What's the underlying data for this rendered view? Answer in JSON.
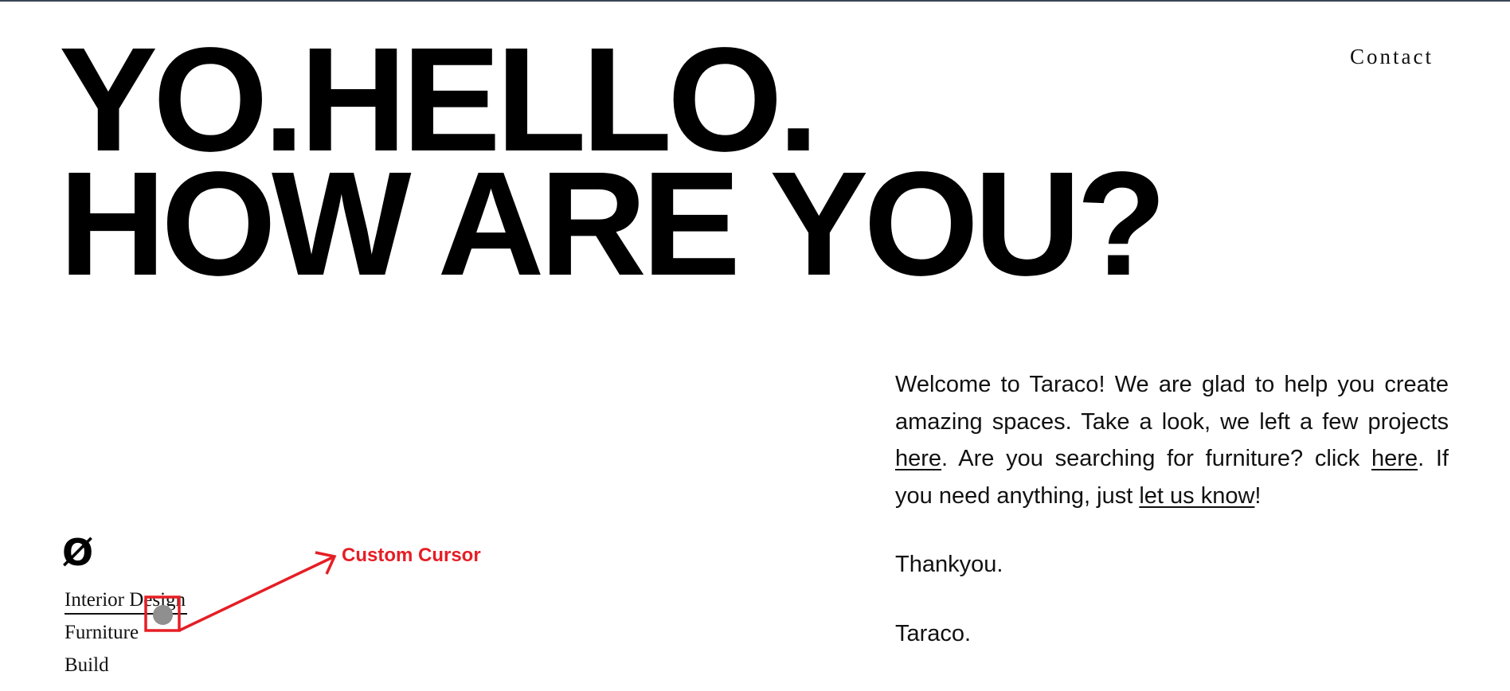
{
  "nav": {
    "contact_label": "Contact"
  },
  "hero": {
    "line1": "YO.HELLO.",
    "line2": "HOW ARE YOU?"
  },
  "brand": {
    "logo_glyph": "Ø"
  },
  "menu": {
    "items": [
      {
        "label": "Interior Design",
        "active": true
      },
      {
        "label": "Furniture",
        "active": false
      },
      {
        "label": "Build",
        "active": false
      }
    ]
  },
  "annotation": {
    "label": "Custom Cursor",
    "color": "#e51e25"
  },
  "intro": {
    "p1_a": "Welcome to Taraco! We are glad to help you create amazing spaces. Take a look, we left a few projects ",
    "link_projects": "here",
    "p1_b": ". Are you searching for furniture? click ",
    "link_furniture": "here",
    "p1_c": ". If you need anything, just ",
    "link_contact": "let us know",
    "p1_d": "!",
    "thanks": "Thankyou.",
    "signature": "Taraco."
  },
  "colors": {
    "background": "#ffffff",
    "text": "#000000",
    "top_border": "#3a4656",
    "cursor_dot": "#8f8f8f"
  }
}
